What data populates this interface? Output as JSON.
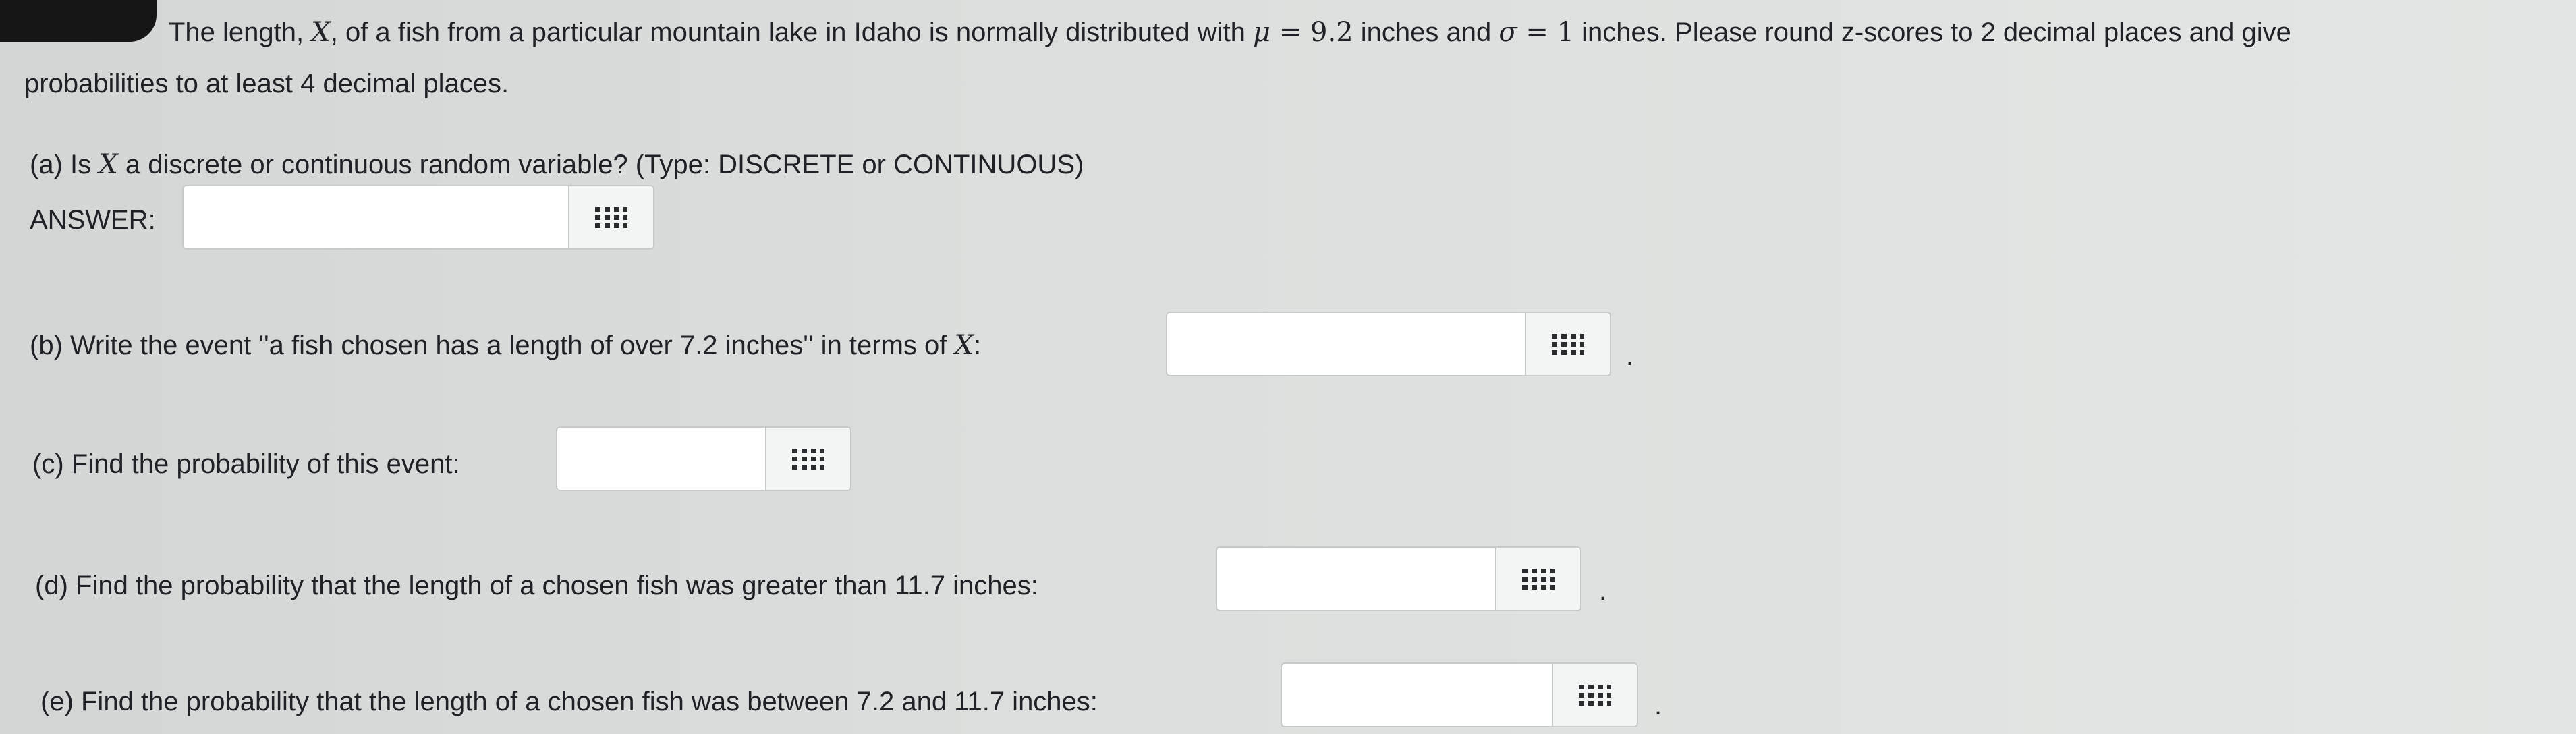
{
  "intro": {
    "line1_part1": "The length, ",
    "var_x": "X",
    "line1_part2": ", of a fish from a particular mountain lake in Idaho is normally distributed with ",
    "mu_symbol": "μ",
    "eq": " = ",
    "mu_value": "9.2",
    "line1_part3": " inches and ",
    "sigma_symbol": "σ",
    "sigma_value": "1",
    "line1_part4": " inches. Please round z-scores to 2 decimal places and give",
    "line2": "probabilities to at least 4 decimal places."
  },
  "part_a": {
    "question_pre": "(a) Is ",
    "question_post": " a discrete or continuous random variable? (Type: DISCRETE or CONTINUOUS)",
    "answer_label": "ANSWER:",
    "answer_value": ""
  },
  "part_b": {
    "question_pre": "(b) Write the event ''a fish chosen has a length of over 7.2 inches'' in terms of ",
    "question_post": ":",
    "answer_value": "",
    "trailing": "."
  },
  "part_c": {
    "question": "(c) Find the probability of this event:",
    "answer_value": ""
  },
  "part_d": {
    "question": "(d) Find the probability that the length of a chosen fish was greater than 11.7 inches:",
    "answer_value": "",
    "trailing": "."
  },
  "part_e": {
    "question": "(e) Find the probability that the length of a chosen fish was between 7.2 and 11.7 inches:",
    "answer_value": "",
    "trailing": "."
  },
  "icons": {
    "keypad": "keypad-icon"
  }
}
